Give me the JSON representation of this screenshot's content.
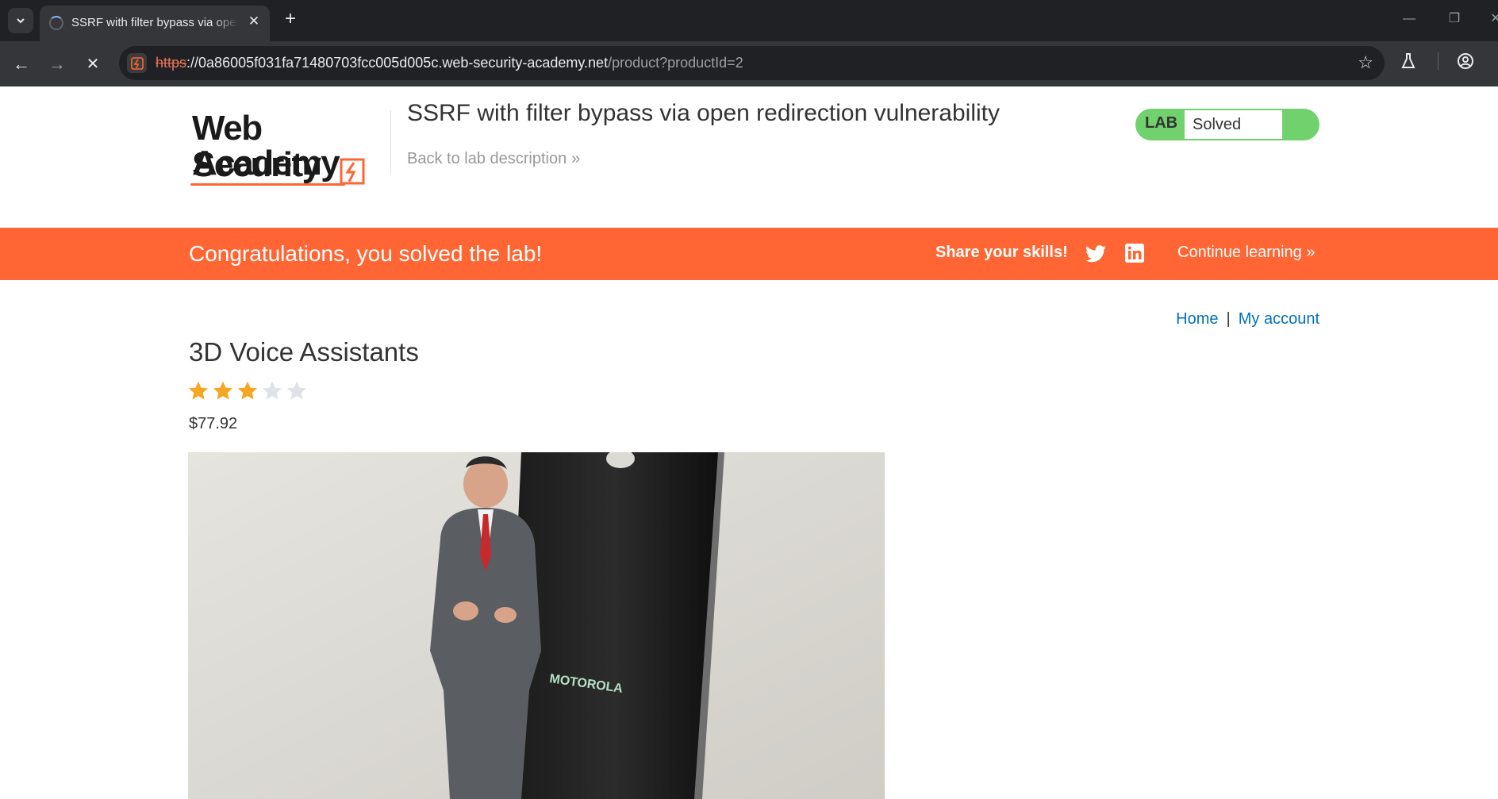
{
  "browser": {
    "tab_title": "SSRF with filter bypass via open redirection vulnerability",
    "url_scheme": "https",
    "url_host": "://0a86005f031fa71480703fcc005d005c.web-security-academy.net",
    "url_path": "/product?productId=2"
  },
  "header": {
    "logo_line1": "Web Security",
    "logo_line2": "Academy",
    "lab_title": "SSRF with filter bypass via open redirection vulnerability",
    "back_link": "Back to lab description",
    "lab_tag": "LAB",
    "lab_status": "Solved"
  },
  "banner": {
    "message": "Congratulations, you solved the lab!",
    "share_label": "Share your skills!",
    "continue_label": "Continue learning"
  },
  "nav": {
    "home": "Home",
    "separator": "|",
    "my_account": "My account"
  },
  "product": {
    "name": "3D Voice Assistants",
    "rating": 3,
    "rating_max": 5,
    "price": "$77.92",
    "image_text": "MOTOROLA"
  },
  "colors": {
    "accent": "#ff6633",
    "status_green": "#70d16d",
    "link": "#0071bc",
    "star_filled": "#f5a623",
    "star_empty": "#dfe3e8"
  }
}
